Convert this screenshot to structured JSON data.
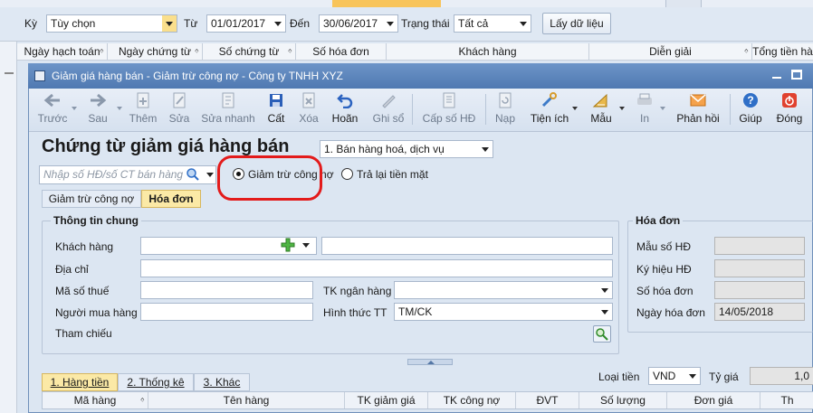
{
  "filter": {
    "ky_label": "Kỳ",
    "ky_value": "Tùy chọn",
    "tu_label": "Từ",
    "tu_value": "01/01/2017",
    "den_label": "Đến",
    "den_value": "30/06/2017",
    "trang_thai_label": "Trạng thái",
    "trang_thai_value": "Tất cả",
    "get_data_button": "Lấy dữ liệu"
  },
  "grid": {
    "columns": [
      "Ngày hạch toán",
      "Ngày chứng từ",
      "Số chứng từ",
      "Số hóa đơn",
      "Khách hàng",
      "Diễn giải",
      "Tổng tiền hà"
    ]
  },
  "window": {
    "title": "Giảm giá hàng bán - Giảm trừ công nợ - Công ty TNHH XYZ"
  },
  "toolbar": {
    "buttons": [
      {
        "label": "Trước",
        "icon": "arrow-left-icon"
      },
      {
        "label": "Sau",
        "icon": "arrow-right-icon"
      },
      {
        "label": "Thêm",
        "icon": "add-document-icon"
      },
      {
        "label": "Sửa",
        "icon": "edit-document-icon"
      },
      {
        "label": "Sửa nhanh",
        "icon": "quick-edit-icon"
      },
      {
        "label": "Cất",
        "icon": "save-icon"
      },
      {
        "label": "Xóa",
        "icon": "delete-icon"
      },
      {
        "label": "Hoãn",
        "icon": "undo-icon"
      },
      {
        "label": "Ghi sổ",
        "icon": "pencil-icon"
      },
      {
        "label": "Cấp số HĐ",
        "icon": "invoice-number-icon"
      },
      {
        "label": "Nạp",
        "icon": "reload-icon"
      },
      {
        "label": "Tiện ích",
        "icon": "tools-icon"
      },
      {
        "label": "Mẫu",
        "icon": "template-icon"
      },
      {
        "label": "In",
        "icon": "print-icon"
      },
      {
        "label": "Phản hồi",
        "icon": "feedback-mail-icon"
      },
      {
        "label": "Giúp",
        "icon": "help-icon"
      },
      {
        "label": "Đóng",
        "icon": "close-power-icon"
      }
    ]
  },
  "form": {
    "title": "Chứng từ giảm giá hàng bán",
    "type_value": "1. Bán hàng hoá, dịch vụ",
    "search_placeholder": "Nhập số HĐ/số CT bán hàng",
    "radio_giam_tru": "Giảm trừ công nợ",
    "radio_tra_lai": "Trả lại tiền mặt",
    "tabs": [
      "Giảm trừ công nợ",
      "Hóa đơn"
    ],
    "general_group": "Thông tin chung",
    "khach_hang_label": "Khách hàng",
    "dia_chi_label": "Địa chỉ",
    "ma_so_thue_label": "Mã số thuế",
    "tk_ngan_hang_label": "TK ngân hàng",
    "nguoi_mua_label": "Người mua hàng",
    "hinh_thuc_tt_label": "Hình thức TT",
    "hinh_thuc_tt_value": "TM/CK",
    "tham_chieu_label": "Tham chiếu",
    "invoice_group": "Hóa đơn",
    "mau_so_label": "Mẫu số HĐ",
    "ky_hieu_label": "Ký hiệu HĐ",
    "so_hoa_don_label": "Số hóa đơn",
    "ngay_hoa_don_label": "Ngày hóa đơn",
    "ngay_hoa_don_value": "14/05/2018"
  },
  "detail": {
    "tabs": [
      "1. Hàng tiền",
      "2. Thống kê",
      "3. Khác"
    ],
    "loai_tien_label": "Loại tiền",
    "loai_tien_value": "VND",
    "ty_gia_label": "Tỷ giá",
    "ty_gia_value": "1,0",
    "columns": [
      "Mã hàng",
      "Tên hàng",
      "TK giảm giá",
      "TK công nợ",
      "ĐVT",
      "Số lượng",
      "Đơn giá",
      "Th"
    ]
  },
  "colors": {
    "highlight_circle": "#e31b1b",
    "accent_tab": "#fbe9a6",
    "window_titlebar": "#5b86bd"
  }
}
